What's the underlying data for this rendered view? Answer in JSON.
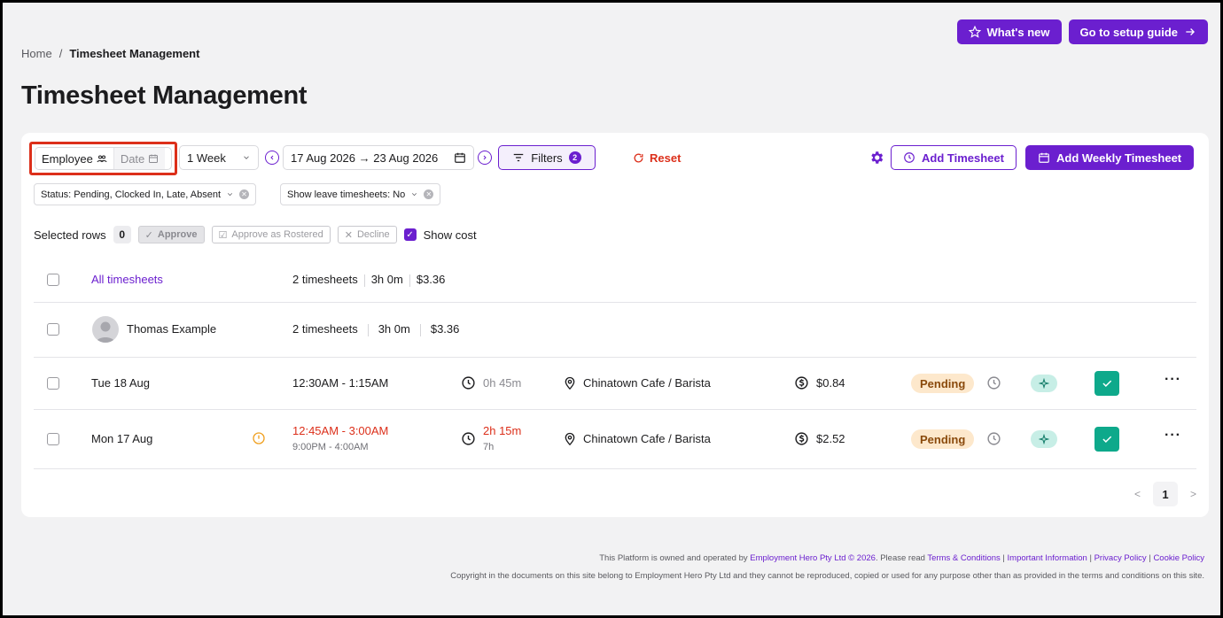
{
  "header": {
    "whats_new": "What's new",
    "setup_guide": "Go to setup guide"
  },
  "breadcrumb": {
    "home": "Home",
    "sep": "/",
    "current": "Timesheet Management"
  },
  "page_title": "Timesheet Management",
  "toolbar": {
    "view_employee": "Employee",
    "view_date": "Date",
    "period": "1 Week",
    "date_range": "17 Aug 2026 → 23 Aug 2026",
    "filters_label": "Filters",
    "filters_count": "2",
    "reset": "Reset",
    "add_timesheet": "Add Timesheet",
    "add_weekly": "Add Weekly Timesheet"
  },
  "chips": [
    {
      "label": "Status: Pending, Clocked In, Late, Absent"
    },
    {
      "label": "Show leave timesheets: No"
    }
  ],
  "selection": {
    "label": "Selected rows",
    "count": "0",
    "approve": "Approve",
    "approve_rostered": "Approve as Rostered",
    "decline": "Decline",
    "show_cost": "Show cost"
  },
  "summary": {
    "all_label": "All timesheets",
    "all_count": "2 timesheets",
    "all_hours": "3h 0m",
    "all_cost": "$3.36",
    "employee_name": "Thomas Example",
    "emp_count": "2 timesheets",
    "emp_hours": "3h 0m",
    "emp_cost": "$3.36"
  },
  "timesheets": [
    {
      "date": "Tue 18 Aug",
      "time": "12:30AM - 1:15AM",
      "rostered": "",
      "duration": "0h 45m",
      "duration_sub": "",
      "location": "Chinatown Cafe / Barista",
      "cost": "$0.84",
      "status": "Pending"
    },
    {
      "date": "Mon 17 Aug",
      "time": "12:45AM - 3:00AM",
      "rostered": "9:00PM - 4:00AM",
      "duration": "2h 15m",
      "duration_sub": "7h",
      "location": "Chinatown Cafe / Barista",
      "cost": "$2.52",
      "status": "Pending"
    }
  ],
  "pagination": {
    "prev": "<",
    "page": "1",
    "next": ">"
  },
  "footer": {
    "line1_a": "This Platform is owned and operated by",
    "line1_company": "Employment Hero Pty Ltd © 2026",
    "line1_b": ". Please read",
    "terms": "Terms & Conditions",
    "important": "Important Information",
    "privacy": "Privacy Policy",
    "cookie": "Cookie Policy",
    "line2": "Copyright in the documents on this site belong to Employment Hero Pty Ltd and they cannot be reproduced, copied or used for any purpose other than as provided in the terms and conditions on this site."
  },
  "colors": {
    "accent": "#6b1fcf",
    "danger": "#dc2f1a",
    "pending_bg": "#fde8cc",
    "approve_green": "#0ea98b"
  }
}
